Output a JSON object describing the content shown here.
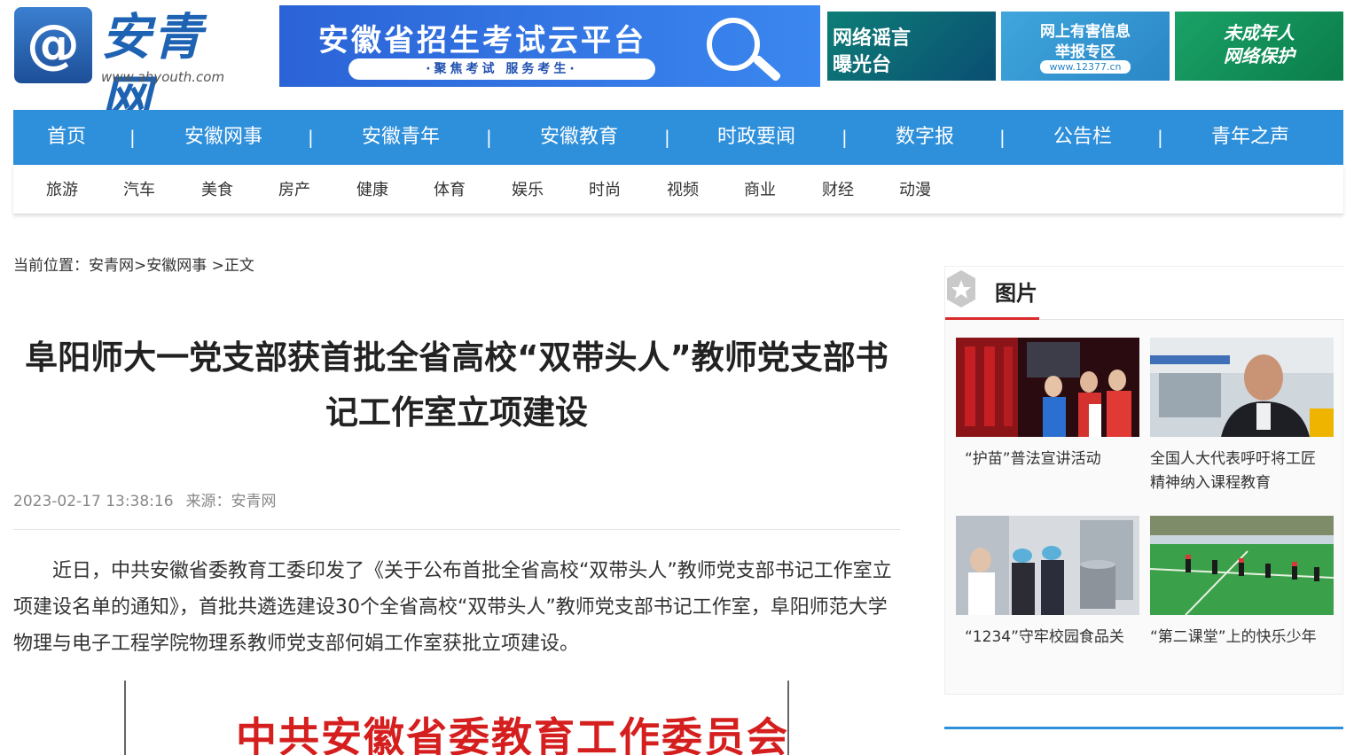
{
  "header": {
    "logo": {
      "mark": "@",
      "name": "安青网",
      "url": "www.ahyouth.com"
    },
    "banner_main": {
      "title": "安徽省招生考试云平台",
      "subtitle": "·聚焦考试 服务考生·"
    },
    "side_banners": [
      {
        "line1": "网络谣言",
        "line2": "曝光台"
      },
      {
        "line1": "网上有害信息",
        "line2": "举报专区",
        "line3": "www.12377.cn"
      },
      {
        "line1": "未成年人",
        "line2": "网络保护"
      }
    ]
  },
  "nav": {
    "main": [
      "首页",
      "安徽网事",
      "安徽青年",
      "安徽教育",
      "时政要闻",
      "数字报",
      "公告栏",
      "青年之声"
    ],
    "separator": "|",
    "sub": [
      "旅游",
      "汽车",
      "美食",
      "房产",
      "健康",
      "体育",
      "娱乐",
      "时尚",
      "视频",
      "商业",
      "财经",
      "动漫"
    ]
  },
  "breadcrumb": {
    "label": "当前位置：",
    "items": [
      "安青网",
      "安徽网事",
      "正文"
    ],
    "sep": ">"
  },
  "article": {
    "title": "阜阳师大一党支部获首批全省高校“双带头人”教师党支部书记工作室立项建设",
    "date": "2023-02-17 13:38:16",
    "source": "来源：安青网",
    "body": "近日，中共安徽省委教育工委印发了《关于公布首批全省高校“双带头人”教师党支部书记工作室立项建设名单的通知》，首批共遴选建设30个全省高校“双带头人”教师党支部书记工作室，阜阳师范大学物理与电子工程学院物理系教师党支部何娟工作室获批立项建设。",
    "doc_heading": "中共安徽省委教育工作委员会"
  },
  "sidebar": {
    "title": "图片",
    "pictures": [
      {
        "caption": "“护苗”普法宣讲活动",
        "icon": "photo-students-dark-room"
      },
      {
        "caption": "全国人大代表呼吁将工匠精神纳入课程教育",
        "icon": "photo-man-portrait"
      },
      {
        "caption": "“1234”守牢校园食品关",
        "icon": "photo-kitchen"
      },
      {
        "caption": "“第二课堂”上的快乐少年",
        "icon": "photo-field-children"
      }
    ]
  },
  "colors": {
    "nav_blue": "#2e8fdb",
    "accent_red": "#d92b2b",
    "doc_red": "#d51f1f"
  }
}
